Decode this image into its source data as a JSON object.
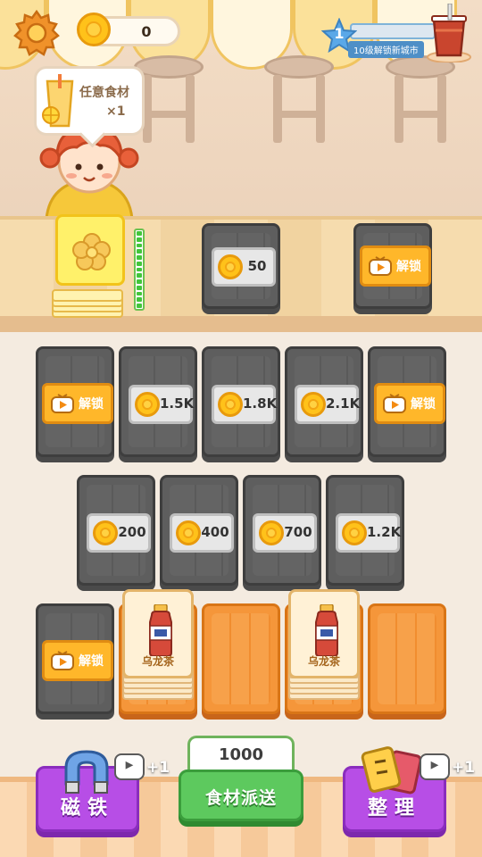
{
  "hud": {
    "coins": "0",
    "level": "1",
    "level_caption": "10级解锁新城市"
  },
  "bubble": {
    "title": "任意食材",
    "count": "×1"
  },
  "counter_tiles": {
    "price": "50",
    "unlock_label": "解锁"
  },
  "grid": {
    "row1": [
      {
        "kind": "ad",
        "label": "解锁"
      },
      {
        "kind": "price",
        "label": "1.5K"
      },
      {
        "kind": "price",
        "label": "1.8K"
      },
      {
        "kind": "price",
        "label": "2.1K"
      },
      {
        "kind": "ad",
        "label": "解锁"
      }
    ],
    "row2": [
      {
        "kind": "price",
        "label": "200"
      },
      {
        "kind": "price",
        "label": "400"
      },
      {
        "kind": "price",
        "label": "700"
      },
      {
        "kind": "price",
        "label": "1.2K"
      }
    ],
    "row3": [
      {
        "kind": "ad",
        "label": "解锁"
      },
      {
        "kind": "item",
        "label": "乌龙茶"
      },
      {
        "kind": "empty",
        "label": ""
      },
      {
        "kind": "item",
        "label": "乌龙茶"
      },
      {
        "kind": "empty",
        "label": ""
      }
    ]
  },
  "bottom": {
    "magnet_label": "磁铁",
    "magnet_bonus": "+1",
    "dispatch_count": "1000",
    "dispatch_label": "食材派送",
    "sort_label": "整理",
    "sort_bonus": "+1"
  },
  "colors": {
    "accent_yellow": "#ffb72a",
    "price_slot": "#e7e7e7",
    "purple": "#b74ee6",
    "green": "#5dc95e",
    "tile_dark": "#5e5e5e",
    "tile_orange": "#f5963a"
  },
  "icons": [
    "gear-icon",
    "coin-icon",
    "star-icon",
    "tea-cup-icon",
    "tv-ad-icon",
    "magnet-icon",
    "cards-icon",
    "flower-icon",
    "oolong-tea-bottle-icon"
  ]
}
